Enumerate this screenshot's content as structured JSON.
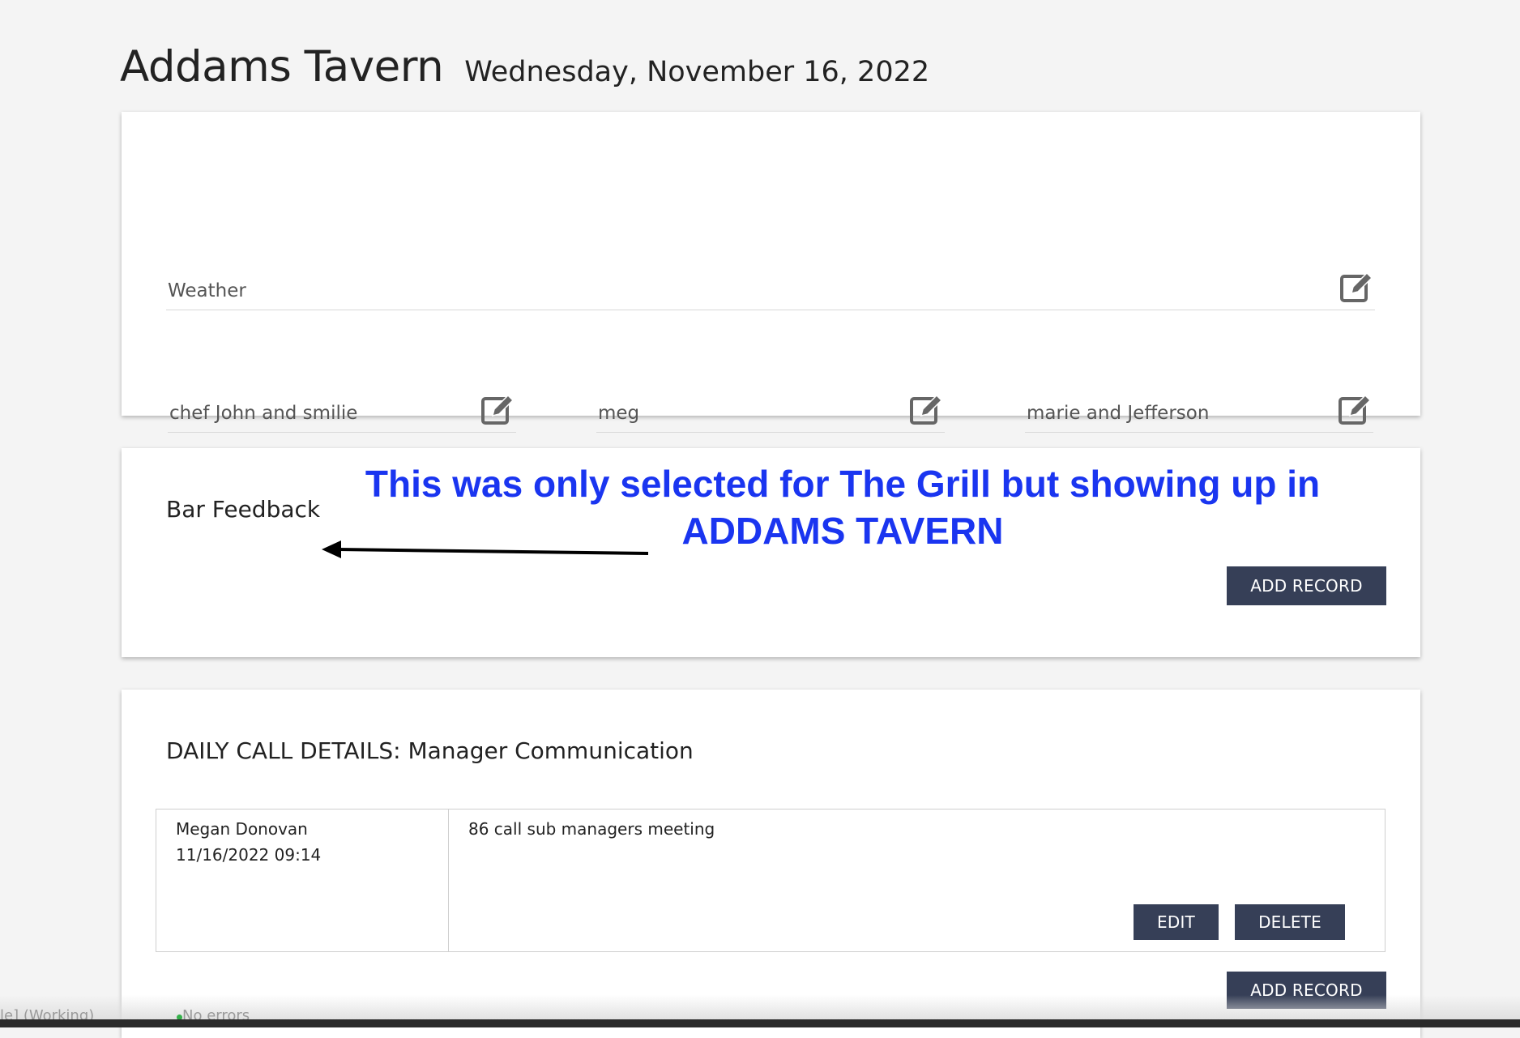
{
  "header": {
    "title": "Addams Tavern",
    "date": "Wednesday, November 16, 2022"
  },
  "weather_card": {
    "weather_label": "Weather",
    "staff_fields": [
      {
        "value": "chef John and smilie"
      },
      {
        "value": "meg"
      },
      {
        "value": "marie and Jefferson"
      }
    ]
  },
  "feedback_card": {
    "title": "Bar Feedback",
    "add_record_label": "ADD RECORD"
  },
  "annotation": {
    "text": "This was only selected for The Grill but showing up in ADDAMS TAVERN",
    "color": "#1a35f0"
  },
  "calls_card": {
    "title": "DAILY CALL DETAILS: Manager Communication",
    "entries": [
      {
        "author": "Megan Donovan",
        "timestamp": "11/16/2022 09:14",
        "message": "86 call sub managers meeting",
        "edit_label": "EDIT",
        "delete_label": "DELETE"
      }
    ],
    "add_record_label": "ADD RECORD"
  },
  "status_bar": {
    "left_text": "le] (Working)",
    "errors_text": "No errors"
  },
  "colors": {
    "button_bg": "#363f57",
    "background": "#f4f4f4",
    "card_bg": "#ffffff"
  },
  "icons": {
    "edit": "edit-square-pencil-icon",
    "arrow": "left-arrow"
  }
}
